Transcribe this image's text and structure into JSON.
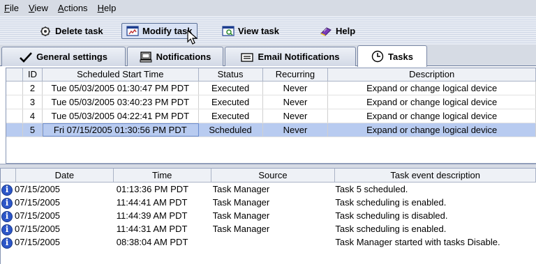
{
  "menu": [
    "File",
    "View",
    "Actions",
    "Help"
  ],
  "toolbar": {
    "delete_label": "Delete task",
    "modify_label": "Modify task",
    "view_label": "View task",
    "help_label": "Help"
  },
  "tabs": [
    {
      "label": "General settings"
    },
    {
      "label": "Notifications"
    },
    {
      "label": "Email Notifications"
    },
    {
      "label": "Tasks",
      "selected": true
    }
  ],
  "task_table": {
    "columns": [
      "ID",
      "Scheduled Start Time",
      "Status",
      "Recurring",
      "Description"
    ],
    "rows": [
      {
        "id": "2",
        "start": "Tue 05/03/2005 01:30:47 PM PDT",
        "status": "Executed",
        "recurring": "Never",
        "description": "Expand or change logical device"
      },
      {
        "id": "3",
        "start": "Tue 05/03/2005 03:40:23 PM PDT",
        "status": "Executed",
        "recurring": "Never",
        "description": "Expand or change logical device"
      },
      {
        "id": "4",
        "start": "Tue 05/03/2005 04:22:41 PM PDT",
        "status": "Executed",
        "recurring": "Never",
        "description": "Expand or change logical device"
      },
      {
        "id": "5",
        "start": "Fri 07/15/2005 01:30:56 PM PDT",
        "status": "Scheduled",
        "recurring": "Never",
        "description": "Expand or change logical device"
      }
    ]
  },
  "event_table": {
    "columns": [
      "Date",
      "Time",
      "Source",
      "Task event description"
    ],
    "rows": [
      {
        "date": "07/15/2005",
        "time": "01:13:36 PM PDT",
        "source": "Task Manager",
        "description": "Task 5 scheduled."
      },
      {
        "date": "07/15/2005",
        "time": "11:44:41 AM PDT",
        "source": "Task Manager",
        "description": "Task scheduling is enabled."
      },
      {
        "date": "07/15/2005",
        "time": "11:44:39 AM PDT",
        "source": "Task Manager",
        "description": "Task scheduling is disabled."
      },
      {
        "date": "07/15/2005",
        "time": "11:44:31 AM PDT",
        "source": "Task Manager",
        "description": "Task scheduling is enabled."
      },
      {
        "date": "07/15/2005",
        "time": "08:38:04 AM PDT",
        "source": "",
        "description": "Task Manager started with tasks Disable."
      }
    ]
  },
  "icons": {
    "delete": "gear-delete-icon",
    "modify": "modify-window-icon",
    "view": "view-window-icon",
    "help": "help-book-icon",
    "general": "checkmark-icon",
    "notifications": "monitor-icon",
    "email": "envelope-icon",
    "tasks": "clock-icon",
    "event": "info-icon"
  },
  "colors": {
    "selected_row": "#b8cbf0",
    "menubar": "#d6dbe4",
    "info_icon": "#2c56c8"
  }
}
